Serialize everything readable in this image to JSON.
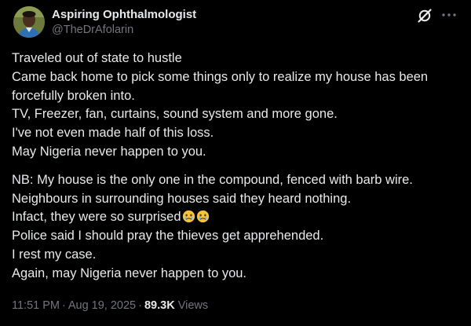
{
  "author": {
    "display_name": "Aspiring Ophthalmologist",
    "handle": "@TheDrAfolarin"
  },
  "icons": {
    "avatar": "profile-photo",
    "grok": "grok-icon",
    "more": "more-icon",
    "emoji": "face-holding-back-tears"
  },
  "tweet": {
    "paragraph_1": [
      "Traveled out of state to hustle",
      "Came back home to pick some things only to realize my house has been",
      "forcefully broken into.",
      "TV, Freezer, fan, curtains, sound system and more gone.",
      "I've not even made half of this loss.",
      "May Nigeria never happen to you."
    ],
    "paragraph_2": [
      "NB: My house is the only one in the compound, fenced with barb wire.",
      "Neighbours in surrounding houses said they heard nothing.",
      "Infact, they were so surprised",
      "Police said I should pray the thieves get apprehended.",
      "I rest my case.",
      "Again, may Nigeria never happen to you."
    ]
  },
  "meta": {
    "time": "11:51 PM",
    "separator": "·",
    "date": "Aug 19, 2025",
    "views_count": "89.3K",
    "views_label": "Views"
  },
  "colors": {
    "background": "#000000",
    "primary_text": "#e7e9ea",
    "secondary_text": "#71767b"
  }
}
